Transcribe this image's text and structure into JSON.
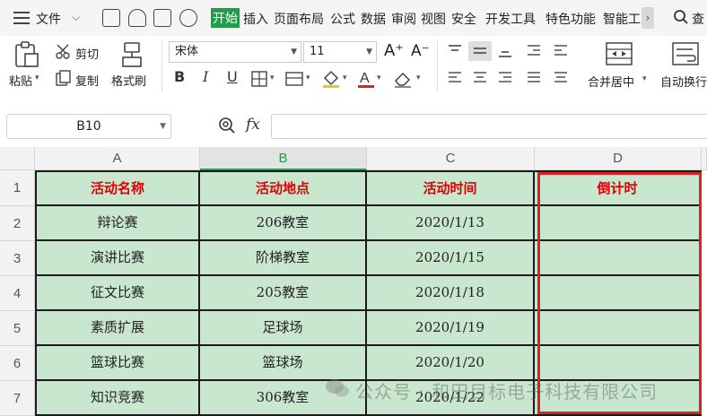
{
  "menubar": {
    "file_label": "文件",
    "tabs": [
      "开始",
      "插入",
      "页面布局",
      "公式",
      "数据",
      "审阅",
      "视图",
      "安全",
      "开发工具",
      "特色功能",
      "智能工"
    ],
    "active_tab": "开始",
    "search_label": "查"
  },
  "ribbon": {
    "paste_label": "粘贴",
    "cut_label": "剪切",
    "copy_label": "复制",
    "format_painter_label": "格式刷",
    "font_name": "宋体",
    "font_size": "11",
    "bold": "B",
    "italic": "I",
    "underline": "U",
    "merge_label": "合并居中",
    "wrap_label": "自动换行"
  },
  "formula_bar": {
    "name_box": "B10",
    "fx_label": "fx",
    "formula": ""
  },
  "sheet": {
    "columns": [
      "A",
      "B",
      "C",
      "D"
    ],
    "selected_column": "B",
    "rows": [
      "1",
      "2",
      "3",
      "4",
      "5",
      "6",
      "7"
    ],
    "header": [
      "活动名称",
      "活动地点",
      "活动时间",
      "倒计时"
    ],
    "data": [
      [
        "辩论赛",
        "206教室",
        "2020/1/13",
        ""
      ],
      [
        "演讲比赛",
        "阶梯教室",
        "2020/1/15",
        ""
      ],
      [
        "征文比赛",
        "205教室",
        "2020/1/18",
        ""
      ],
      [
        "素质扩展",
        "足球场",
        "2020/1/19",
        ""
      ],
      [
        "篮球比赛",
        "篮球场",
        "2020/1/20",
        ""
      ],
      [
        "知识竞赛",
        "306教室",
        "2020/1/22",
        ""
      ]
    ],
    "cell_fill_color": "#c9e7cf",
    "header_text_color": "#e00000",
    "highlight_border_color": "#e02020"
  },
  "watermark": "公众号 · 和田目标电子科技有限公司"
}
